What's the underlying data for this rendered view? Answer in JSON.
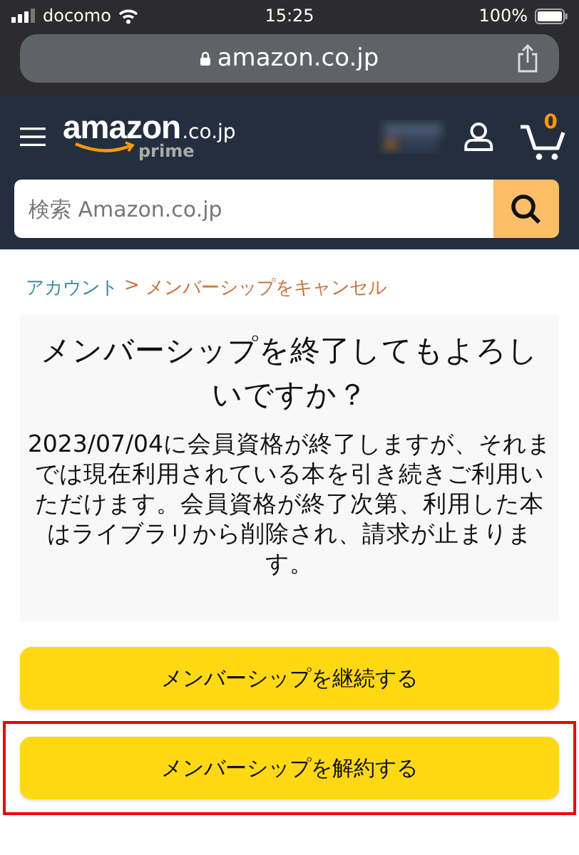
{
  "status_bar": {
    "carrier": "docomo",
    "time": "15:25",
    "battery": "100%"
  },
  "address_bar": {
    "url": "amazon.co.jp"
  },
  "header": {
    "logo": "amazon",
    "logo_suffix": ".co.jp",
    "logo_sub": "prime",
    "cart_count": "0"
  },
  "search": {
    "placeholder": "検索 Amazon.co.jp"
  },
  "breadcrumb": [
    {
      "label": "アカウント",
      "kind": "link"
    },
    {
      "label": ">",
      "kind": "separator"
    },
    {
      "label": "メンバーシップをキャンセル",
      "kind": "current"
    }
  ],
  "title": "メンバーシップを終了してもよろしいですか？",
  "message": "2023/07/04に会員資格が終了しますが、それまでは現在利用されている本を引き続きご利用いただけます。会員資格が終了次第、利用した本はライブラリから削除され、請求が止まります。",
  "buttons": [
    {
      "label": "メンバーシップを継続する",
      "highlighted": false
    },
    {
      "label": "メンバーシップを解約する",
      "highlighted": true
    }
  ]
}
